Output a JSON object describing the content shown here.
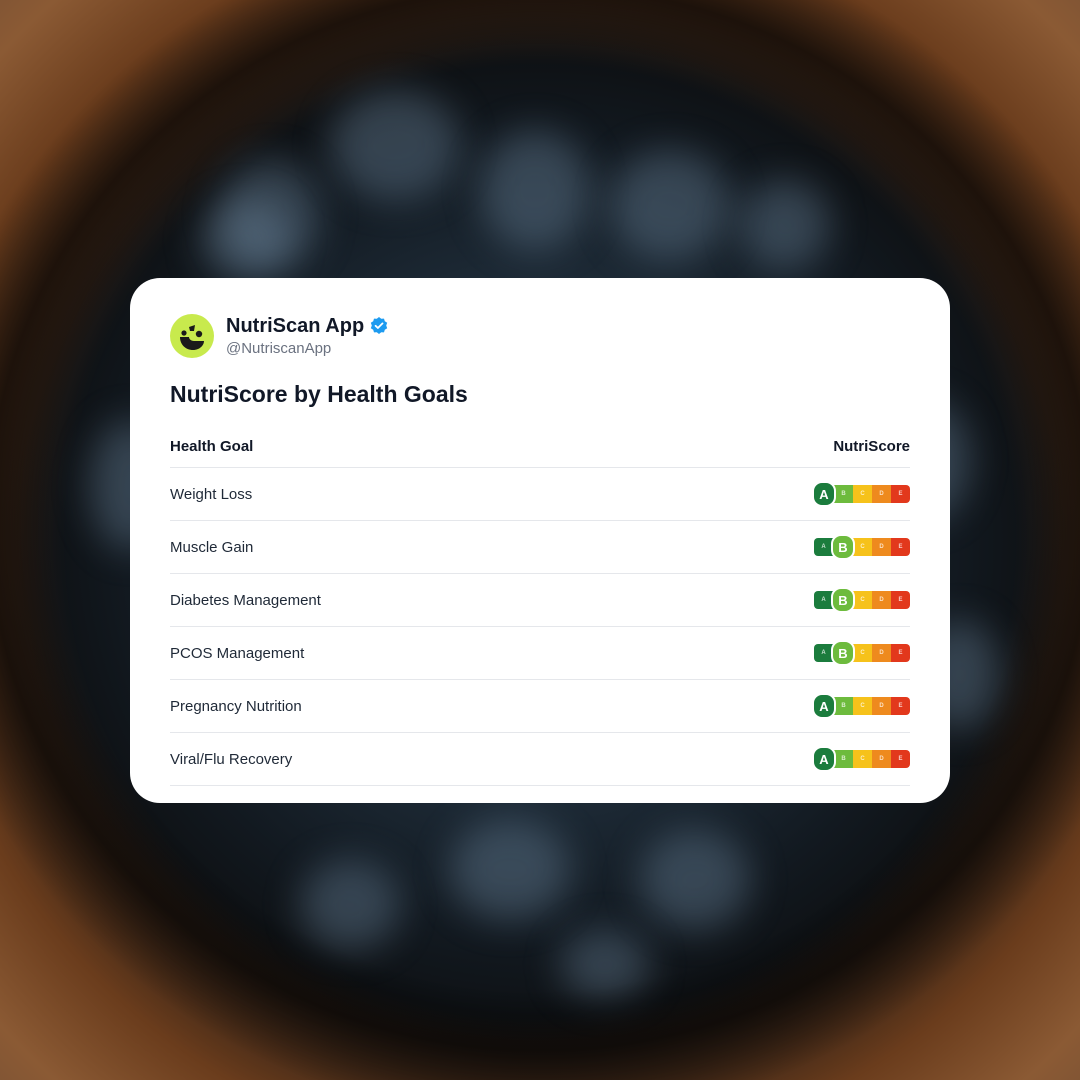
{
  "account": {
    "name": "NutriScan App",
    "handle": "@NutriscanApp",
    "avatar_icon": "nutriscan-logo-icon",
    "verified_icon": "verified-badge-icon",
    "verified_color": "#1d9bf0",
    "avatar_color": "#c8ea4d"
  },
  "title": "NutriScore by Health Goals",
  "table": {
    "headers": {
      "goal": "Health Goal",
      "score": "NutriScore"
    },
    "grades": [
      "A",
      "B",
      "C",
      "D",
      "E"
    ],
    "grade_colors": {
      "A": "#1b7c3d",
      "B": "#6dbb3d",
      "C": "#f6c21b",
      "D": "#ee8a1e",
      "E": "#e2381c"
    },
    "rows": [
      {
        "goal": "Weight Loss",
        "score": "A"
      },
      {
        "goal": "Muscle Gain",
        "score": "B"
      },
      {
        "goal": "Diabetes Management",
        "score": "B"
      },
      {
        "goal": "PCOS Management",
        "score": "B"
      },
      {
        "goal": "Pregnancy Nutrition",
        "score": "A"
      },
      {
        "goal": "Viral/Flu Recovery",
        "score": "A"
      }
    ]
  }
}
